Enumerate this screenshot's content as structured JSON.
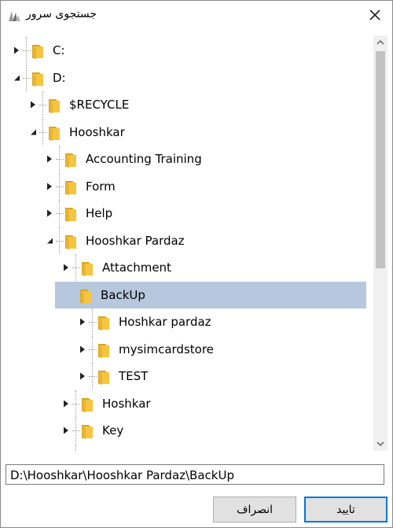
{
  "window": {
    "title": "جستجوی سرور",
    "close_icon": "close-icon",
    "app_icon": "server-search-icon"
  },
  "tree": {
    "nodes": [
      {
        "label": "C:",
        "level": 0,
        "expanded": false,
        "selected": false
      },
      {
        "label": "D:",
        "level": 0,
        "expanded": true,
        "selected": false
      },
      {
        "label": "$RECYCLE",
        "level": 1,
        "expanded": false,
        "selected": false
      },
      {
        "label": "Hooshkar",
        "level": 1,
        "expanded": true,
        "selected": false
      },
      {
        "label": "Accounting Training",
        "level": 2,
        "expanded": false,
        "selected": false
      },
      {
        "label": "Form",
        "level": 2,
        "expanded": false,
        "selected": false
      },
      {
        "label": "Help",
        "level": 2,
        "expanded": false,
        "selected": false
      },
      {
        "label": "Hooshkar Pardaz",
        "level": 2,
        "expanded": true,
        "selected": false
      },
      {
        "label": "Attachment",
        "level": 3,
        "expanded": false,
        "selected": false
      },
      {
        "label": "BackUp",
        "level": 3,
        "expanded": true,
        "selected": true
      },
      {
        "label": "Hoshkar pardaz",
        "level": 4,
        "expanded": false,
        "selected": false
      },
      {
        "label": "mysimcardstore",
        "level": 4,
        "expanded": false,
        "selected": false
      },
      {
        "label": "TEST",
        "level": 4,
        "expanded": false,
        "selected": false
      },
      {
        "label": "Hoshkar",
        "level": 3,
        "expanded": false,
        "selected": false
      },
      {
        "label": "Key",
        "level": 3,
        "expanded": false,
        "selected": false
      },
      {
        "label": "",
        "level": 3,
        "expanded": false,
        "selected": false
      }
    ]
  },
  "path": {
    "value": "D:\\Hooshkar\\Hooshkar Pardaz\\BackUp"
  },
  "buttons": {
    "ok_label": "تایید",
    "cancel_label": "انصراف"
  },
  "colors": {
    "selection": "#b6c7de",
    "folder": "#f5c542",
    "ok_border": "#0078d7"
  }
}
